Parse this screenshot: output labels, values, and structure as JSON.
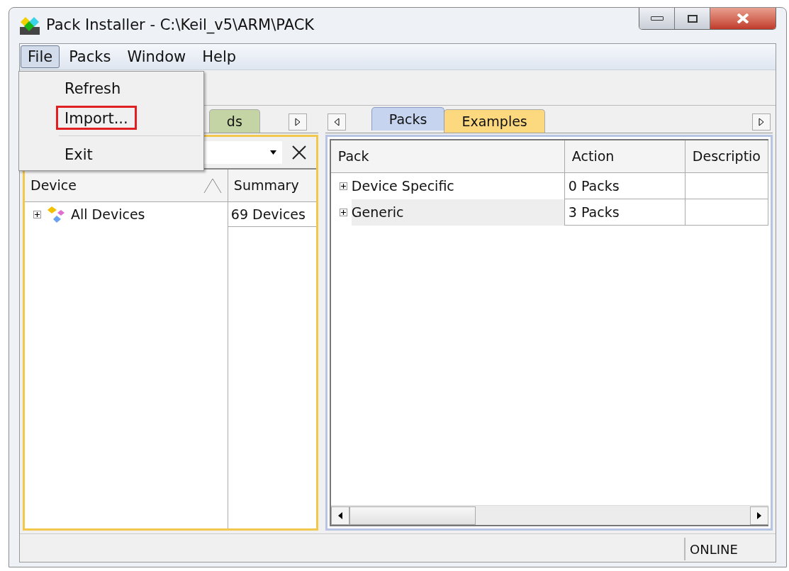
{
  "window": {
    "title": "Pack Installer - C:\\Keil_v5\\ARM\\PACK"
  },
  "menu_bar": [
    {
      "label": "File",
      "selected": true
    },
    {
      "label": "Packs",
      "selected": false
    },
    {
      "label": "Window",
      "selected": false
    },
    {
      "label": "Help",
      "selected": false
    }
  ],
  "file_menu": [
    {
      "kind": "item",
      "label": "Refresh",
      "annotated": false
    },
    {
      "kind": "item",
      "label": "Import...",
      "annotated": true
    },
    {
      "kind": "separator"
    },
    {
      "kind": "item",
      "label": "Exit",
      "annotated": false
    }
  ],
  "left_panel": {
    "tabs": [
      {
        "label": "ds",
        "selected": false,
        "color": "#c4d4a4"
      }
    ],
    "columns": [
      "Device",
      "Summary"
    ],
    "rows": [
      {
        "device": "All Devices",
        "summary": "69 Devices",
        "expanded": false
      }
    ]
  },
  "right_panel": {
    "tabs": [
      {
        "label": "Packs",
        "selected": true,
        "color": "#c6d4ef"
      },
      {
        "label": "Examples",
        "selected": false,
        "color": "#fcd87e"
      }
    ],
    "columns": [
      "Pack",
      "Action",
      "Descriptio"
    ],
    "rows": [
      {
        "pack": "Device Specific",
        "action": "0 Packs",
        "expanded": false
      },
      {
        "pack": "Generic",
        "action": "3 Packs",
        "expanded": false
      }
    ]
  },
  "status_bar": {
    "status": "ONLINE"
  }
}
